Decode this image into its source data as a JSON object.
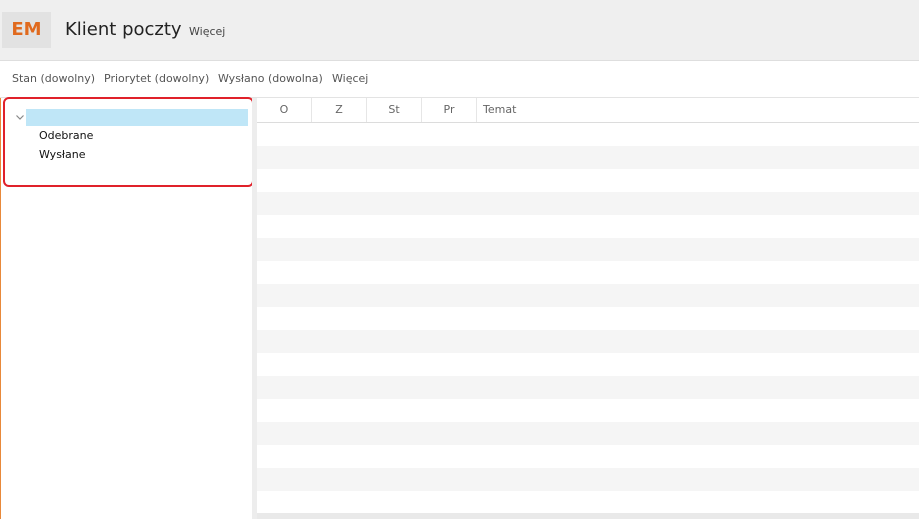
{
  "header": {
    "logo": "EM",
    "title": "Klient poczty",
    "more_label": "Więcej"
  },
  "filters": [
    {
      "label": "Stan (dowolny)"
    },
    {
      "label": "Priorytet (dowolny)"
    },
    {
      "label": "Wysłano (dowolna)"
    },
    {
      "label": "Więcej"
    }
  ],
  "tree": {
    "root_label": "",
    "items": [
      {
        "label": "Odebrane"
      },
      {
        "label": "Wysłane"
      }
    ]
  },
  "columns": [
    {
      "label": "O"
    },
    {
      "label": "Z"
    },
    {
      "label": "St"
    },
    {
      "label": "Pr"
    },
    {
      "label": "Temat"
    }
  ],
  "colors": {
    "accent": "#e06a1e",
    "selection": "#bfe6f7",
    "highlight_border": "#e0212a"
  },
  "icons": [
    "chevron-down-icon"
  ]
}
